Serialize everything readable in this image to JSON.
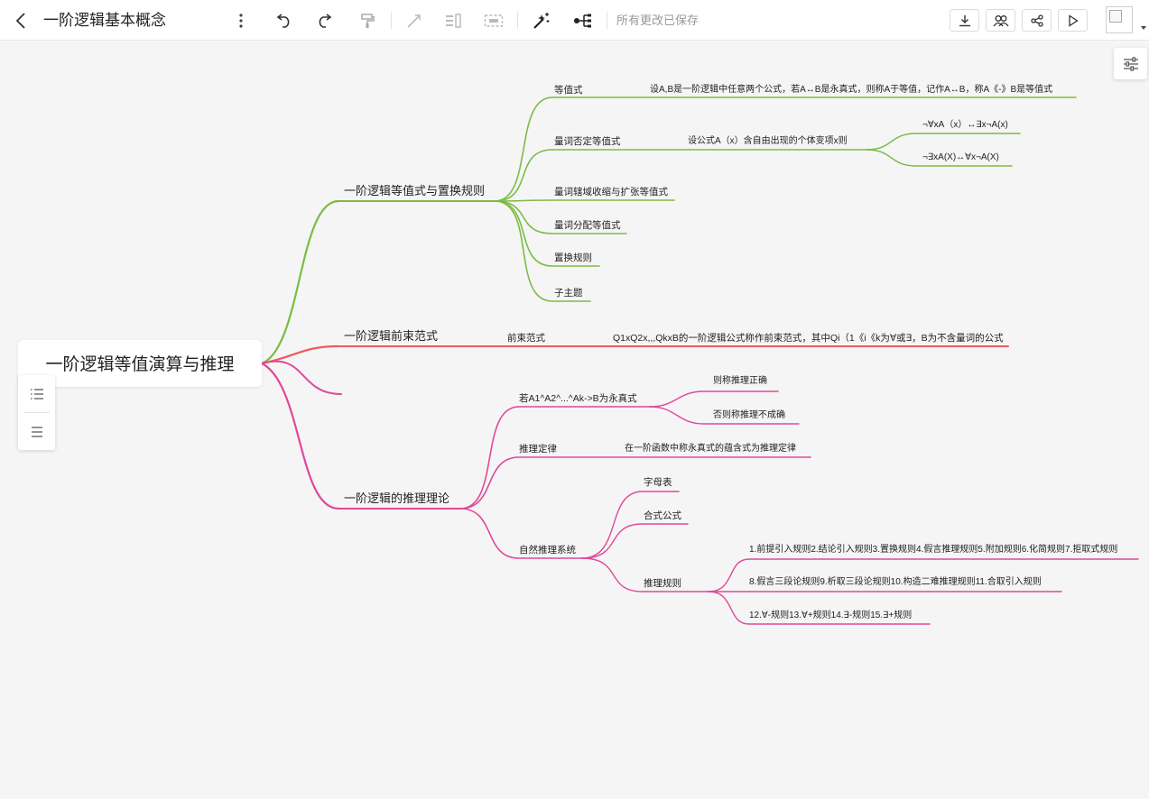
{
  "toolbar": {
    "title": "一阶逻辑基本概念",
    "save_status": "所有更改已保存"
  },
  "colors": {
    "green": "#7cbb45",
    "red": "#ee5a5f",
    "pink": "#e0489a"
  },
  "mindmap": {
    "root": "一阶逻辑等值演算与推理",
    "b1": {
      "title": "一阶逻辑等值式与置换规则",
      "equiv": "等值式",
      "equiv_desc": "设A,B是一阶逻辑中任意两个公式，若A↔B是永真式，则称A于等值，记作A↔B，称A《-》B是等值式",
      "quant_neg": "量词否定等值式",
      "quant_neg_desc": "设公式A（x）含自由出现的个体变项x则",
      "rule1": "¬∀xA（x）↔∃x¬A(x)",
      "rule2": "¬∃xA(X)↔∀x¬A(X)",
      "quant_scope": "量词辖域收缩与扩张等值式",
      "quant_dist": "量词分配等值式",
      "replace": "置换规则",
      "subtopic": "子主题"
    },
    "b2": {
      "title": "一阶逻辑前束范式",
      "prenex": "前束范式",
      "prenex_desc": "Q1xQ2x,,,QkxB的一阶逻辑公式称作前束范式，其中Qi（1《i《k为∀或∃，B为不含量词的公式"
    },
    "b3": {
      "title": "一阶逻辑的推理理论",
      "if_taut": "若A1^A2^...^Ak->B为永真式",
      "valid": "则称推理正确",
      "invalid": "否则称推理不成确",
      "law": "推理定律",
      "law_desc": "在一阶函数中称永真式的蕴含式为推理定律",
      "natural": "自然推理系统",
      "alphabet": "字母表",
      "wff": "合式公式",
      "rules": "推理规则",
      "rules_1": "1.前提引入规则2.结论引入规则3.置换规则4.假言推理规则5.附加规则6.化简规则7.拒取式规则",
      "rules_2": "8.假言三段论规则9.析取三段论规则10.构造二难推理规则11.合取引入规则",
      "rules_3": "12.∀-规则13.∀+规则14.∃-规则15.∃+规则"
    }
  }
}
